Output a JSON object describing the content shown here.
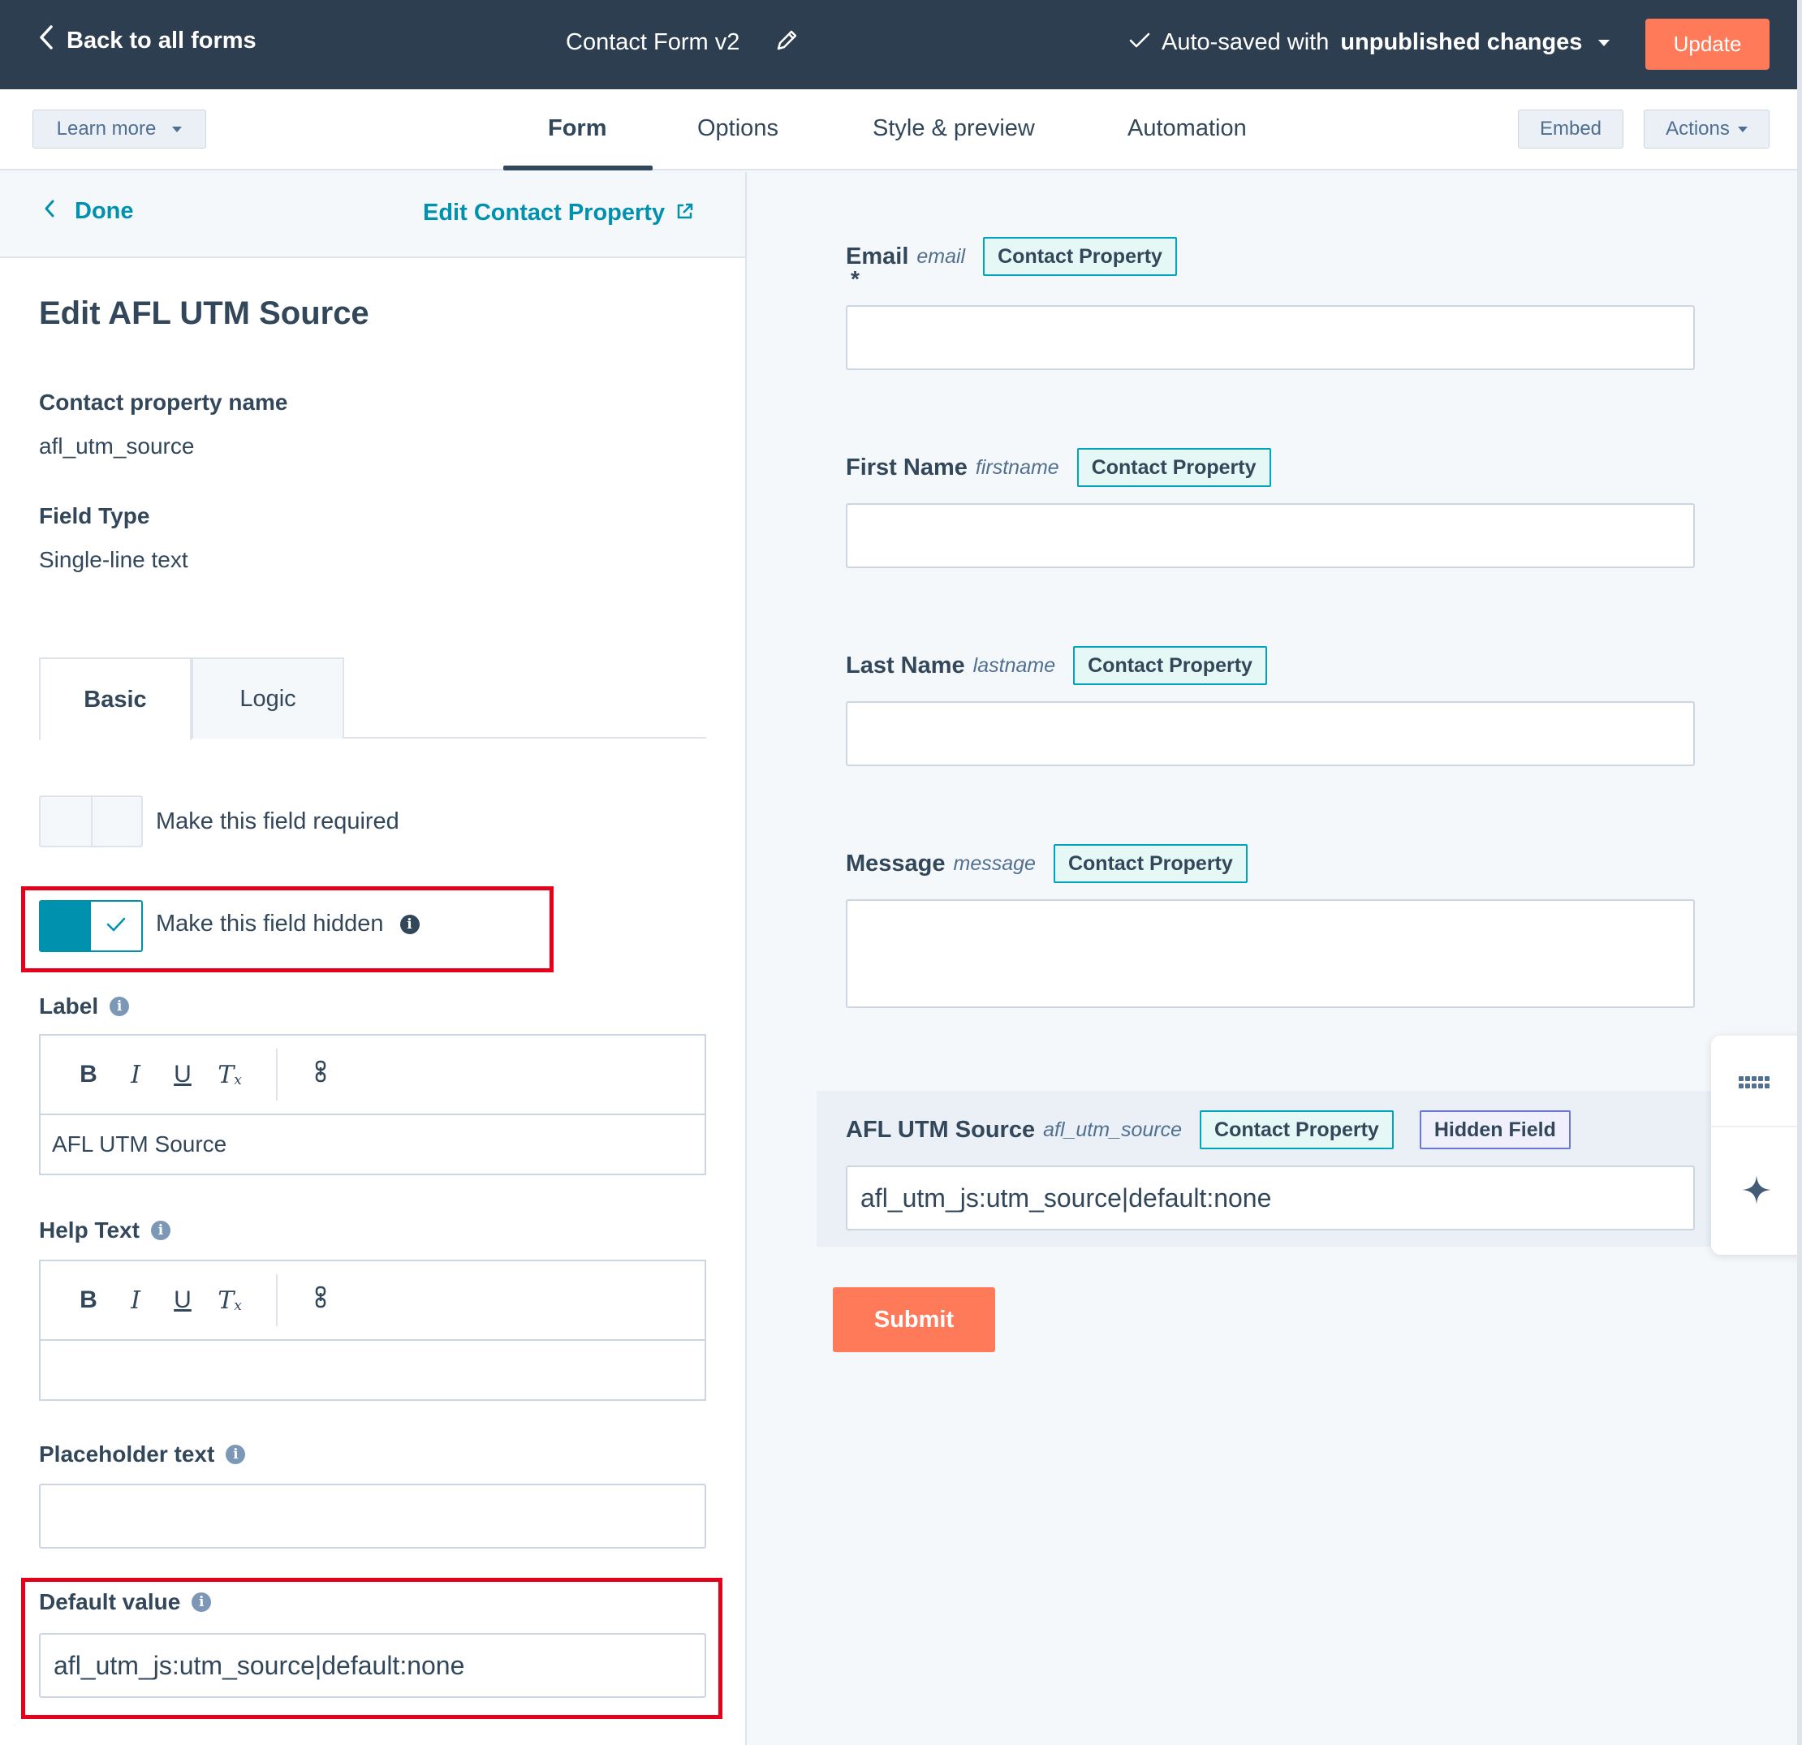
{
  "topbar": {
    "back_label": "Back to all forms",
    "form_name": "Contact Form v2",
    "autosave_prefix": "Auto-saved with",
    "autosave_status": "unpublished changes",
    "update_label": "Update"
  },
  "subnav": {
    "learn_more": "Learn more",
    "tabs": [
      {
        "label": "Form",
        "active": true
      },
      {
        "label": "Options",
        "active": false
      },
      {
        "label": "Style & preview",
        "active": false
      },
      {
        "label": "Automation",
        "active": false
      }
    ],
    "embed": "Embed",
    "actions": "Actions"
  },
  "panel": {
    "done": "Done",
    "edit_property": "Edit Contact Property",
    "title": "Edit AFL UTM Source",
    "property_name_label": "Contact property name",
    "property_name_value": "afl_utm_source",
    "field_type_label": "Field Type",
    "field_type_value": "Single-line text",
    "subtabs": [
      "Basic",
      "Logic"
    ],
    "required_label": "Make this field required",
    "required_on": false,
    "hidden_label": "Make this field hidden",
    "hidden_on": true,
    "label_heading": "Label",
    "label_value": "AFL UTM Source",
    "help_heading": "Help Text",
    "help_value": "",
    "placeholder_heading": "Placeholder text",
    "placeholder_value": "",
    "default_heading": "Default value",
    "default_value": "afl_utm_js:utm_source|default:none",
    "toolbar": {
      "bold": "B",
      "italic": "I",
      "underline": "U",
      "clear": "T",
      "clear_sub": "x"
    }
  },
  "form": {
    "fields": [
      {
        "label": "Email",
        "internal": "email",
        "required_mark": "*",
        "badge": "Contact Property",
        "value": ""
      },
      {
        "label": "First Name",
        "internal": "firstname",
        "badge": "Contact Property",
        "value": ""
      },
      {
        "label": "Last Name",
        "internal": "lastname",
        "badge": "Contact Property",
        "value": ""
      },
      {
        "label": "Message",
        "internal": "message",
        "badge": "Contact Property",
        "value": ""
      },
      {
        "label": "AFL UTM Source",
        "internal": "afl_utm_source",
        "badge": "Contact Property",
        "badge2": "Hidden Field",
        "value": "afl_utm_js:utm_source|default:none"
      }
    ],
    "submit": "Submit"
  },
  "colors": {
    "topbar_bg": "#2d3e50",
    "accent_orange": "#ff7a59",
    "link_teal": "#0091ae",
    "highlight_red": "#e5001b"
  }
}
